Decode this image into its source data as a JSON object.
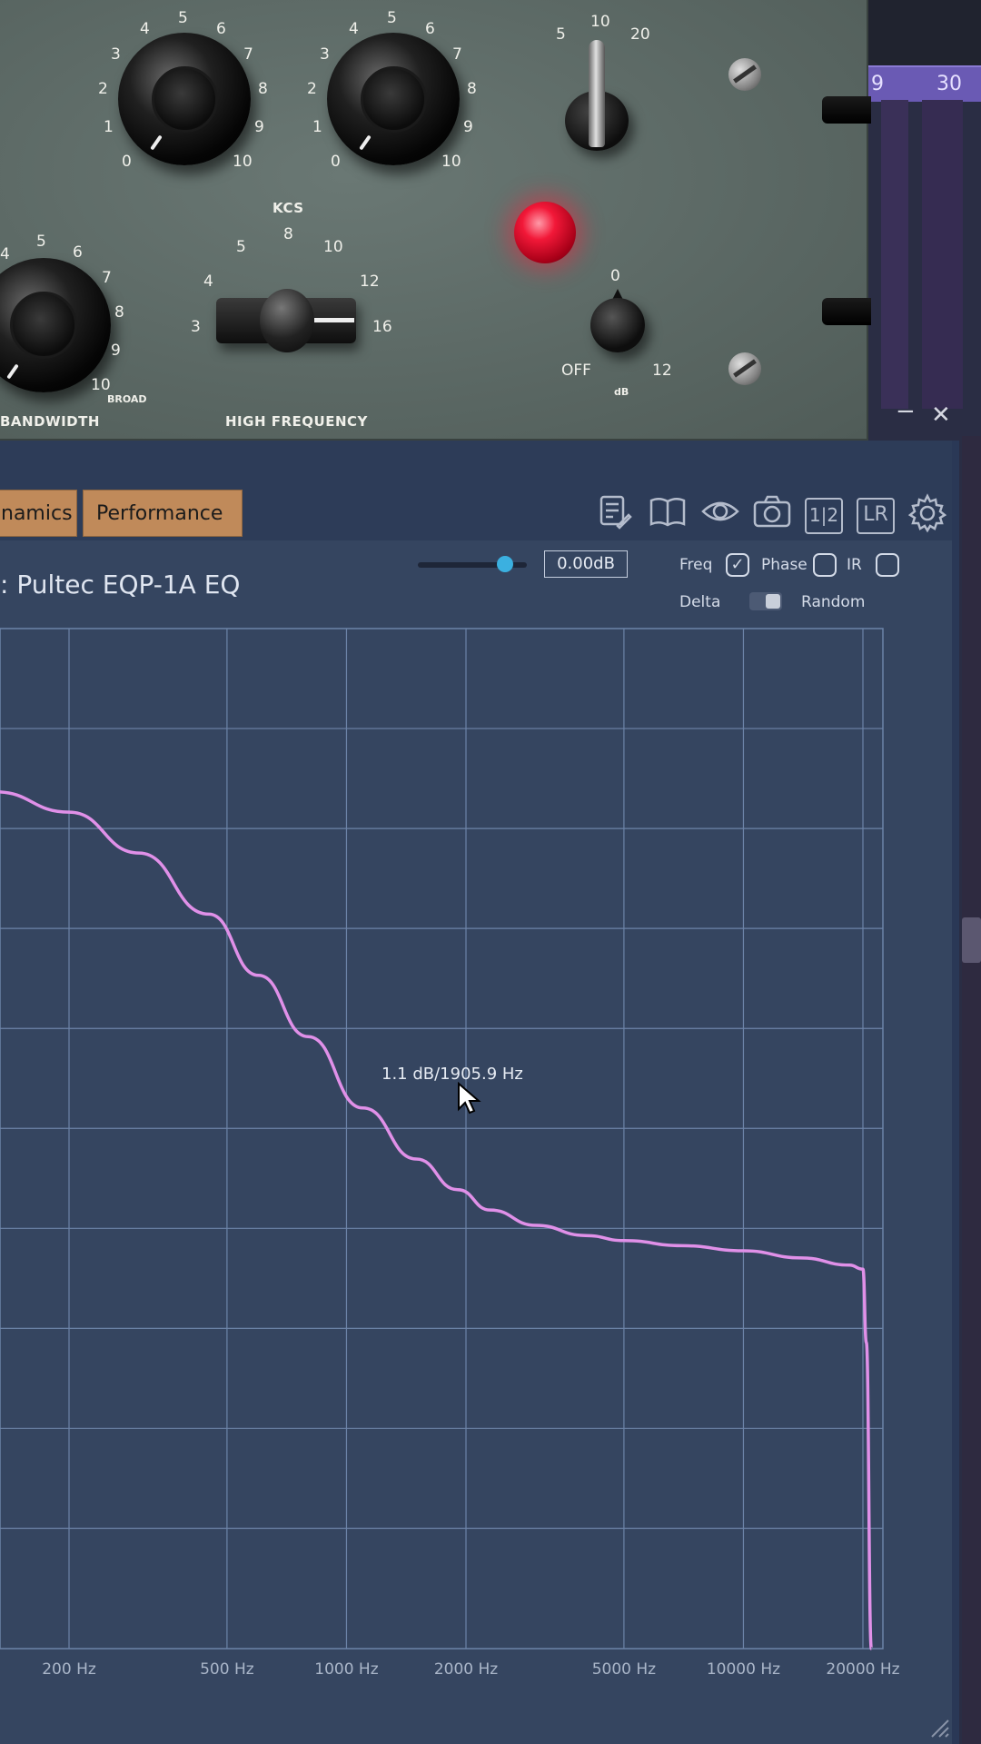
{
  "daw": {
    "ruler_left": "9",
    "ruler_right": "30"
  },
  "plugin_face": {
    "boost_scale": [
      "0",
      "1",
      "2",
      "3",
      "4",
      "5",
      "6",
      "7",
      "8",
      "9",
      "10"
    ],
    "atten_scale": [
      "0",
      "1",
      "2",
      "3",
      "4",
      "5",
      "6",
      "7",
      "8",
      "9",
      "10"
    ],
    "bandwidth_scale": [
      "4",
      "5",
      "6",
      "7",
      "8",
      "9",
      "10"
    ],
    "kcs_label": "KCS",
    "kcs_scale": [
      "3",
      "4",
      "5",
      "8",
      "10",
      "12",
      "16"
    ],
    "atten_sel_scale": [
      "5",
      "10",
      "20"
    ],
    "bandwidth_label": "BANDWIDTH",
    "broad_label": "BROAD",
    "high_frequency_label": "HIGH FREQUENCY",
    "db_scale": {
      "top": "0",
      "left": "OFF",
      "right": "12",
      "unit": "dB"
    }
  },
  "window_controls": {
    "minimize": "−",
    "close": "✕"
  },
  "tabs": [
    {
      "label": "namics"
    },
    {
      "label": "Performance"
    }
  ],
  "toolbar": {
    "icons": [
      "notes-icon",
      "book-icon",
      "eye-icon",
      "camera-icon",
      "ab-compare-icon",
      "lr-icon",
      "gear-icon"
    ],
    "ab_label": "1|2",
    "lr_label": "LR"
  },
  "plot_title": ": Pultec EQP-1A EQ",
  "gain": {
    "value": "0.00dB",
    "slider_position": 0.8
  },
  "options": {
    "freq_label": "Freq",
    "freq_checked": true,
    "phase_label": "Phase",
    "phase_checked": false,
    "ir_label": "IR",
    "ir_checked": false,
    "delta_label": "Delta",
    "random_label": "Random"
  },
  "tooltip": "1.1 dB/1905.9 Hz",
  "chart_data": {
    "type": "line",
    "x_scale": "log",
    "xlabel": "",
    "ylabel": "",
    "x_ticks": [
      {
        "value": 200,
        "label": "200 Hz"
      },
      {
        "value": 500,
        "label": "500 Hz"
      },
      {
        "value": 1000,
        "label": "1000 Hz"
      },
      {
        "value": 2000,
        "label": "2000 Hz"
      },
      {
        "value": 5000,
        "label": "5000 Hz"
      },
      {
        "value": 10000,
        "label": "10000 Hz"
      },
      {
        "value": 20000,
        "label": "20000 Hz"
      }
    ],
    "grid": true,
    "color": "#e090e8",
    "series": [
      {
        "points": [
          [
            130,
            0.84
          ],
          [
            200,
            0.82
          ],
          [
            300,
            0.78
          ],
          [
            450,
            0.72
          ],
          [
            600,
            0.66
          ],
          [
            800,
            0.6
          ],
          [
            1100,
            0.53
          ],
          [
            1500,
            0.48
          ],
          [
            1906,
            0.45
          ],
          [
            2300,
            0.43
          ],
          [
            3000,
            0.415
          ],
          [
            4000,
            0.405
          ],
          [
            5000,
            0.4
          ],
          [
            7000,
            0.395
          ],
          [
            10000,
            0.39
          ],
          [
            14000,
            0.383
          ],
          [
            18500,
            0.376
          ],
          [
            20000,
            0.372
          ],
          [
            20400,
            0.3
          ],
          [
            21000,
            0.0
          ]
        ]
      }
    ]
  }
}
